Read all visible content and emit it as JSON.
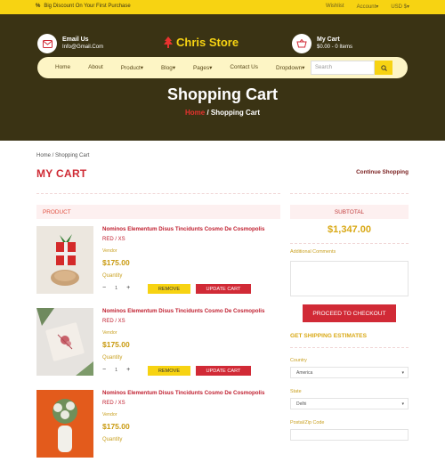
{
  "topbar": {
    "promo": "Big Discount On Your First Purchase",
    "wishlist": "Wishlist",
    "account": "Account",
    "currency": "USD $"
  },
  "header": {
    "email_label": "Email Us",
    "email": "Info@Gmail.Com",
    "logo": "Chris Store",
    "cart_label": "My Cart",
    "cart_value": "$0.00 - 0 Items"
  },
  "nav": {
    "items": [
      "Home",
      "About",
      "Product",
      "Blog",
      "Pages",
      "Contact Us",
      "Dropdown"
    ],
    "search_placeholder": "Search"
  },
  "hero": {
    "title": "Shopping Cart",
    "crumb_home": "Home",
    "crumb_sep": " / ",
    "crumb_current": "Shopping Cart"
  },
  "page": {
    "breadcrumb": "Home / Shopping Cart",
    "heading": "MY CART",
    "continue": "Continue Shopping"
  },
  "table": {
    "product_header": "PRODUCT",
    "subtotal_header": "SUBTOTAL"
  },
  "items": [
    {
      "name": "Nominos Elementum Disus Tincidunts Cosmo De Cosmopolis",
      "variant": "RED / XS",
      "vendor": "Vendor",
      "price": "$175.00",
      "qty_label": "Quantity",
      "qty": "1",
      "remove": "REMOVE",
      "update": "UPDATE CART"
    },
    {
      "name": "Nominos Elementum Disus Tincidunts Cosmo De Cosmopolis",
      "variant": "RED / XS",
      "vendor": "Vendor",
      "price": "$175.00",
      "qty_label": "Quantity",
      "qty": "1",
      "remove": "REMOVE",
      "update": "UPDATE CART"
    },
    {
      "name": "Nominos Elementum Disus Tincidunts Cosmo De Cosmopolis",
      "variant": "RED / XS",
      "vendor": "Vendor",
      "price": "$175.00",
      "qty_label": "Quantity"
    }
  ],
  "summary": {
    "subtotal": "$1,347.00",
    "additional_comments": "Additional Comments",
    "checkout": "PROCEED TO CHECKOUT",
    "shipping_title": "GET SHIPPING ESTIMATES",
    "country_label": "Country",
    "country_value": "America",
    "state_label": "State",
    "state_value": "Delhi",
    "zip_label": "Postal/Zip Code"
  },
  "colors": {
    "yellow": "#f7d312",
    "dark": "#3a3314",
    "red": "#d12a36"
  }
}
